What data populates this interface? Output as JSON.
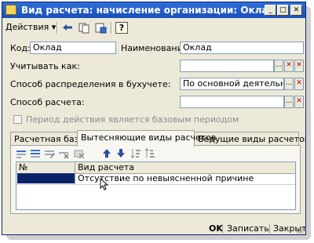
{
  "window": {
    "title": "Вид расчета: начисление организации: Оклад",
    "minimize_glyph": "_",
    "maximize_glyph": "□",
    "close_glyph": "✕"
  },
  "toolbar": {
    "actions_label": "Действия",
    "actions_arrow": "▾",
    "help_glyph": "?"
  },
  "form": {
    "code_label": "Код:",
    "code_value": "Оклад",
    "name_label": "Наименование:",
    "name_value": "Оклад",
    "consider_as_label": "Учитывать как:",
    "consider_as_value": "",
    "distribution_label": "Способ распределения в бухучете:",
    "distribution_value": "По основной деятельности",
    "calc_method_label": "Способ расчета:",
    "calc_method_value": "",
    "base_period_label": "Период действия является базовым периодом",
    "select_glyph": "...",
    "clear_glyph": "✕"
  },
  "tabs": [
    {
      "label": "Расчетная база"
    },
    {
      "label": "Вытесняющие виды расчетов"
    },
    {
      "label": "Ведущие виды расчетов"
    }
  ],
  "grid": {
    "col_num": "№",
    "col_type": "Вид расчета",
    "rows": [
      {
        "num": "",
        "type": "Отсутствие по невыясненной причине"
      }
    ]
  },
  "footer": {
    "ok_label": "OK",
    "save_label": "Записать",
    "close_label": "Закрыть"
  },
  "colors": {
    "title_bar": "#1a4fb8",
    "selection": "#0a246a",
    "window_bg": "#ece9d8"
  }
}
